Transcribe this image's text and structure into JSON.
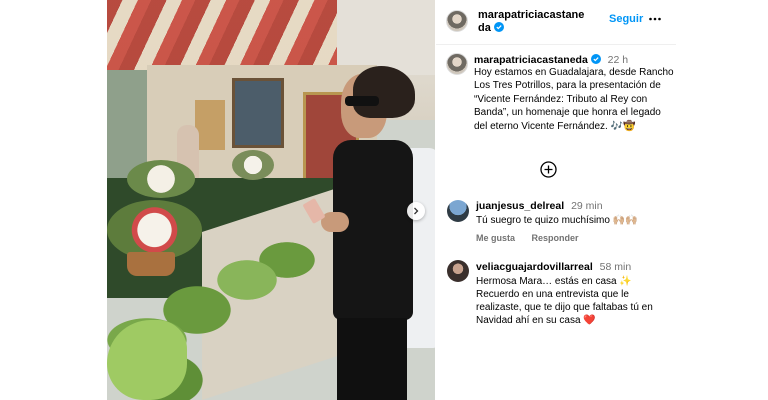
{
  "post": {
    "username": "marapatriciacastaneda",
    "follow_label": "Seguir",
    "caption": {
      "username": "marapatriciacastaneda",
      "time": "22 h",
      "text": "Hoy estamos en Guadalajara, desde Rancho Los Tres Potrillos, para la presentación de “Vicente Fernández: Tributo al Rey con Banda”, un homenaje que honra el legado del eterno Vicente Fernández. 🎶🤠"
    }
  },
  "comments": [
    {
      "username": "juanjesus_delreal",
      "time": "29 min",
      "text": "Tú suegro te quizo muchísimo 🙌🏼🙌🏼",
      "like_label": "Me gusta",
      "reply_label": "Responder"
    },
    {
      "username": "veliacguajardovillarreal",
      "time": "58 min",
      "text": "Hermosa Mara… estás en casa ✨ Recuerdo en una entrevista que le realizaste, que te dijo que faltabas tú en Navidad ahí en su casa ❤️"
    }
  ],
  "icons": {
    "verified": "verified-badge-icon",
    "more": "more-options-icon",
    "add": "add-circle-icon",
    "next": "chevron-right-icon"
  },
  "colors": {
    "link_blue": "#0095f6",
    "muted": "#737373"
  }
}
